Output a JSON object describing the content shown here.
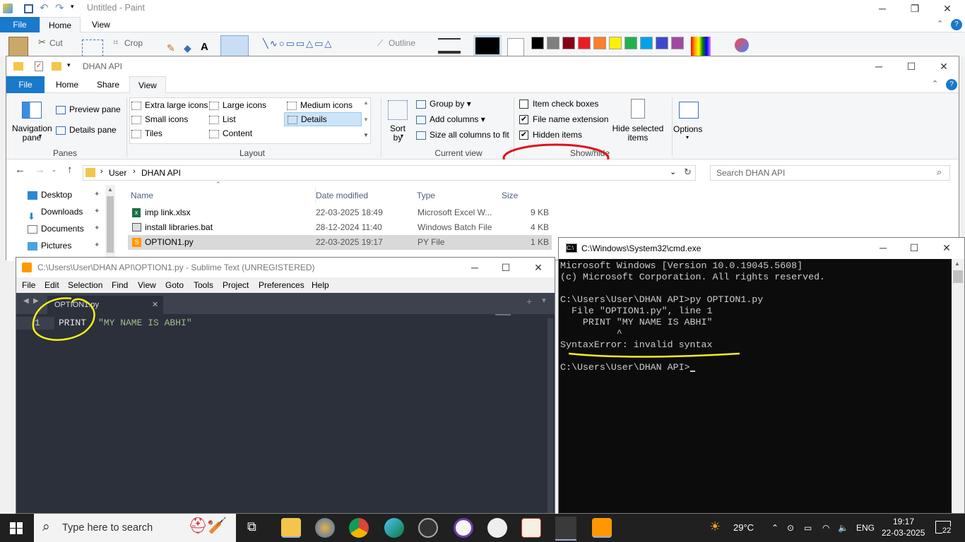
{
  "paint": {
    "title": "Untitled - Paint",
    "tabs": [
      "File",
      "Home",
      "View"
    ],
    "tools": {
      "cut": "Cut",
      "crop": "Crop",
      "outline": "Outline"
    },
    "palette": [
      "#000000",
      "#7f7f7f",
      "#880015",
      "#ed1c24",
      "#ff7f27",
      "#fff200",
      "#22b14c",
      "#00a2e8",
      "#3f48cc",
      "#a349a4"
    ]
  },
  "explorer": {
    "title": "DHAN API",
    "tabs": {
      "file": "File",
      "home": "Home",
      "share": "Share",
      "view": "View"
    },
    "panes": {
      "navigation": "Navigation\npane",
      "preview": "Preview pane",
      "details": "Details pane",
      "label": "Panes"
    },
    "layout": {
      "items": [
        "Extra large icons",
        "Large icons",
        "Medium icons",
        "Small icons",
        "List",
        "Details",
        "Tiles",
        "Content"
      ],
      "label": "Layout"
    },
    "current_view": {
      "sort": "Sort\nby",
      "group_by": "Group by",
      "add_columns": "Add columns",
      "size_all": "Size all columns to fit",
      "label": "Current view"
    },
    "show_hide": {
      "item_check_boxes": "Item check boxes",
      "file_name_extensions": "File name extension",
      "hidden_items": "Hidden items",
      "hide_selected": "Hide selected\nitems",
      "label": "Show/hide"
    },
    "options": "Options",
    "breadcrumb": [
      "User",
      "DHAN API"
    ],
    "search_placeholder": "Search DHAN API",
    "nav_items": [
      "Desktop",
      "Downloads",
      "Documents",
      "Pictures"
    ],
    "columns": {
      "name": "Name",
      "date": "Date modified",
      "type": "Type",
      "size": "Size"
    },
    "files": [
      {
        "name": "imp link.xlsx",
        "date": "22-03-2025 18:49",
        "type": "Microsoft Excel W...",
        "size": "9 KB"
      },
      {
        "name": "install libraries.bat",
        "date": "28-12-2024 11:40",
        "type": "Windows Batch File",
        "size": "4 KB"
      },
      {
        "name": "OPTION1.py",
        "date": "22-03-2025 19:17",
        "type": "PY File",
        "size": "1 KB"
      }
    ]
  },
  "sublime": {
    "title": "C:\\Users\\User\\DHAN API\\OPTION1.py - Sublime Text (UNREGISTERED)",
    "menu": [
      "File",
      "Edit",
      "Selection",
      "Find",
      "View",
      "Goto",
      "Tools",
      "Project",
      "Preferences",
      "Help"
    ],
    "tab": "OPTION1.py",
    "line_number": "1",
    "code_keyword": "PRINT",
    "code_string": "\"MY NAME IS ABHI\""
  },
  "cmd": {
    "title": "C:\\Windows\\System32\\cmd.exe",
    "lines": [
      "Microsoft Windows [Version 10.0.19045.5608]",
      "(c) Microsoft Corporation. All rights reserved.",
      "",
      "C:\\Users\\User\\DHAN API>py OPTION1.py",
      "  File \"OPTION1.py\", line 1",
      "    PRINT \"MY NAME IS ABHI\"",
      "          ^",
      "SyntaxError: invalid syntax",
      "",
      "C:\\Users\\User\\DHAN API>"
    ]
  },
  "taskbar": {
    "search_placeholder": "Type here to search",
    "weather": "29°C",
    "language": "ENG",
    "time": "19:17",
    "date": "22-03-2025",
    "notifications": "22"
  }
}
